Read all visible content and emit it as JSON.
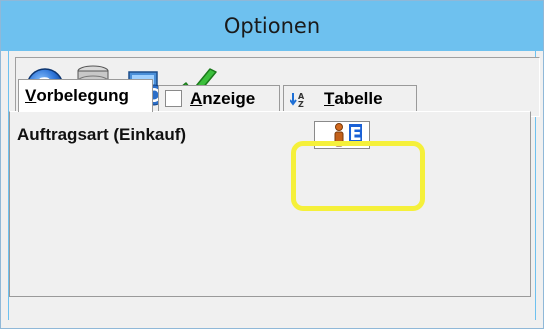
{
  "window": {
    "title": "Optionen"
  },
  "toolbar": {
    "buttons": [
      {
        "icon": "help-icon"
      },
      {
        "icon": "database-search-icon"
      },
      {
        "icon": "refresh-screen-icon"
      },
      {
        "icon": "checkmark-icon"
      }
    ]
  },
  "tabs": [
    {
      "label": "Vorbelegung",
      "accelerator": "V",
      "rest": "orbelegung",
      "active": true
    },
    {
      "label": "Anzeige",
      "accelerator": "A",
      "rest": "nzeige",
      "icon": "checkbox-icon",
      "active": false
    },
    {
      "label": "Tabelle",
      "accelerator": "T",
      "rest": "abelle",
      "icon": "sort-az-icon",
      "active": false
    }
  ],
  "fields": {
    "auftragsart": {
      "label": "Auftragsart (Einkauf)",
      "value": "E",
      "icon": "info-icon"
    }
  },
  "colors": {
    "titlebar": "#6ec1ef",
    "highlight": "#f5f03a",
    "value_bg": "#1a61d6"
  }
}
